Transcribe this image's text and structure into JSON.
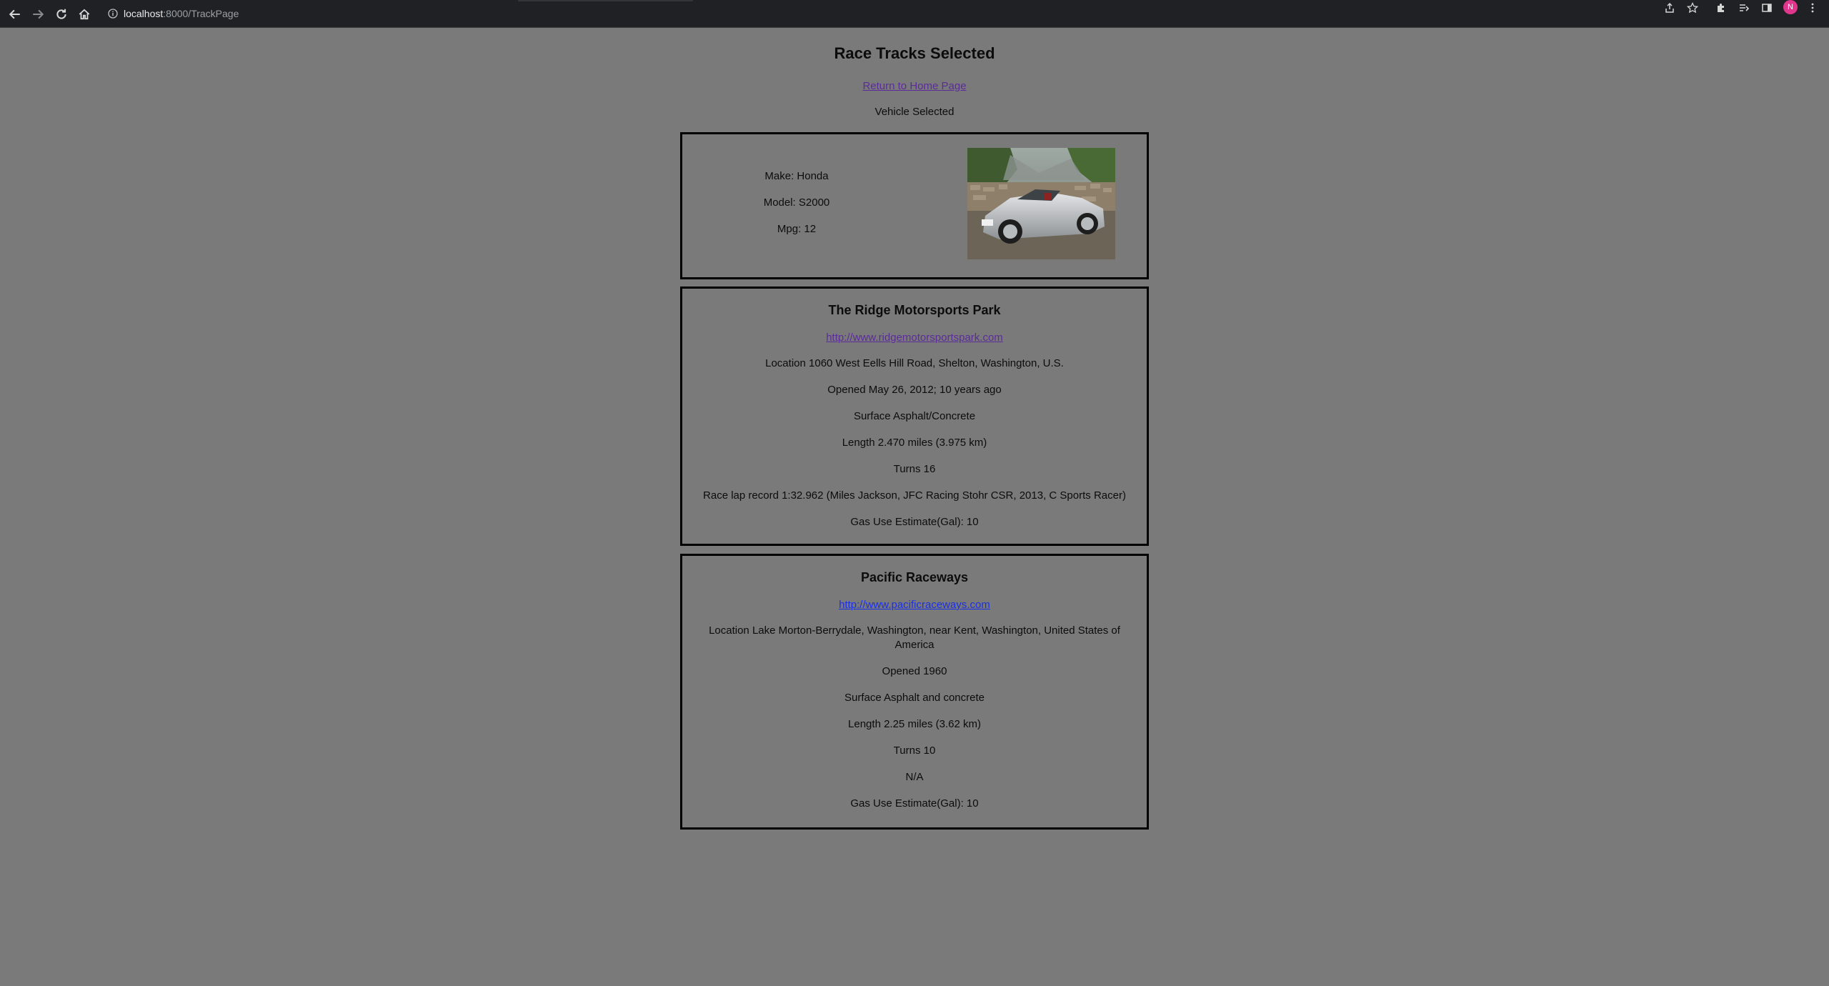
{
  "browser": {
    "url_host": "localhost",
    "url_path": ":8000/TrackPage",
    "avatar_letter": "N"
  },
  "page": {
    "title": "Race Tracks Selected",
    "home_link": "Return to Home Page",
    "vehicle_heading": "Vehicle Selected"
  },
  "vehicle": {
    "make": "Make: Honda",
    "model": "Model: S2000",
    "mpg": "Mpg: 12",
    "image_alt": "silver Honda S2000 convertible"
  },
  "tracks": [
    {
      "name": "The Ridge Motorsports Park",
      "url": "http://www.ridgemotorsportspark.com",
      "location": "Location 1060 West Eells Hill Road, Shelton, Washington, U.S.",
      "opened": "Opened May 26, 2012; 10 years ago",
      "surface": "Surface Asphalt/Concrete",
      "length": "Length 2.470 miles (3.975 km)",
      "turns": "Turns 16",
      "record": "Race lap record 1:32.962 (Miles Jackson, JFC Racing Stohr CSR, 2013, C Sports Racer)",
      "gas": "Gas Use Estimate(Gal): 10"
    },
    {
      "name": "Pacific Raceways",
      "url": "http://www.pacificraceways.com",
      "location": "Location Lake Morton-Berrydale, Washington, near Kent, Washington, United States of America",
      "opened": "Opened 1960",
      "surface": "Surface Asphalt and concrete",
      "length": "Length 2.25 miles (3.62 km)",
      "turns": "Turns 10",
      "record": "N/A",
      "gas": "Gas Use Estimate(Gal): 10"
    }
  ],
  "colors": {
    "page_background": "#7a7a7a",
    "chrome_background": "#202124",
    "visited_link": "#5b2b9a",
    "unvisited_link": "#1a2fe8",
    "avatar": "#e0368c"
  }
}
